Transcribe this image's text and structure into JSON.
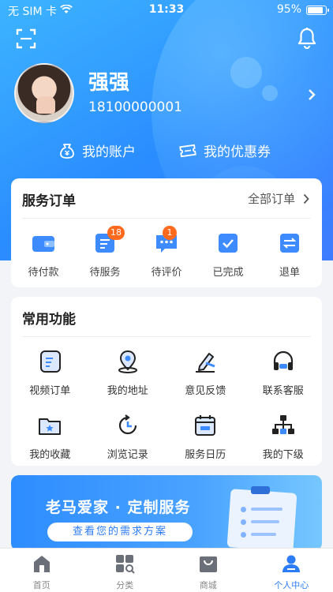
{
  "status_bar": {
    "carrier": "无 SIM 卡",
    "time": "11:33",
    "battery": "95%"
  },
  "profile": {
    "name": "强强",
    "phone": "18100000001"
  },
  "account_links": {
    "account": "我的账户",
    "coupons": "我的优惠券"
  },
  "orders": {
    "title": "服务订单",
    "all_label": "全部订单",
    "items": [
      {
        "label": "待付款",
        "icon": "wallet-icon",
        "badge": ""
      },
      {
        "label": "待服务",
        "icon": "service-doc-icon",
        "badge": "18"
      },
      {
        "label": "待评价",
        "icon": "comment-icon",
        "badge": "1"
      },
      {
        "label": "已完成",
        "icon": "check-icon",
        "badge": ""
      },
      {
        "label": "退单",
        "icon": "refund-icon",
        "badge": ""
      }
    ]
  },
  "functions": {
    "title": "常用功能",
    "items": [
      {
        "label": "视频订单",
        "icon": "video-order-icon"
      },
      {
        "label": "我的地址",
        "icon": "location-icon"
      },
      {
        "label": "意见反馈",
        "icon": "edit-icon"
      },
      {
        "label": "联系客服",
        "icon": "headset-icon"
      },
      {
        "label": "我的收藏",
        "icon": "folder-star-icon"
      },
      {
        "label": "浏览记录",
        "icon": "history-icon"
      },
      {
        "label": "服务日历",
        "icon": "calendar-icon"
      },
      {
        "label": "我的下级",
        "icon": "org-icon"
      }
    ]
  },
  "banner": {
    "title": "老马爱家 · 定制服务",
    "button": "查看您的需求方案"
  },
  "tabbar": {
    "items": [
      {
        "label": "首页",
        "icon": "home-icon",
        "active": false
      },
      {
        "label": "分类",
        "icon": "category-icon",
        "active": false
      },
      {
        "label": "商城",
        "icon": "shop-icon",
        "active": false
      },
      {
        "label": "个人中心",
        "icon": "profile-icon",
        "active": true
      }
    ]
  },
  "colors": {
    "primary": "#2b7cf6",
    "badge": "#ff6a1f",
    "icon_blue": "#3d8bff"
  }
}
